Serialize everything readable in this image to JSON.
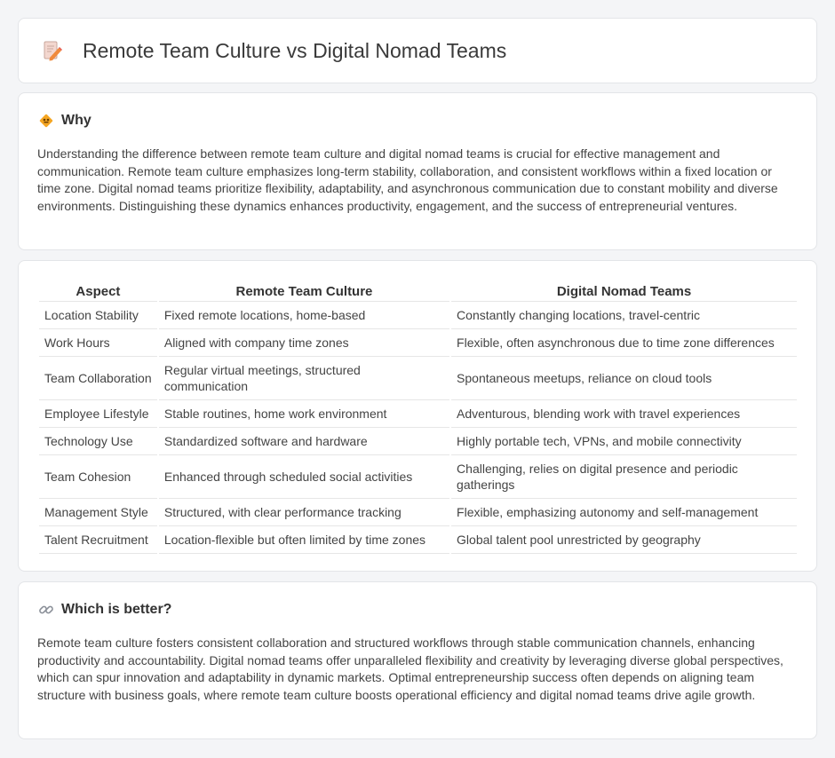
{
  "header": {
    "title": "Remote Team Culture vs Digital Nomad Teams",
    "icon": "pencil-document-icon"
  },
  "why": {
    "heading": "Why",
    "icon": "diamond-sign-icon",
    "text": "Understanding the difference between remote team culture and digital nomad teams is crucial for effective management and communication. Remote team culture emphasizes long-term stability, collaboration, and consistent workflows within a fixed location or time zone. Digital nomad teams prioritize flexibility, adaptability, and asynchronous communication due to constant mobility and diverse environments. Distinguishing these dynamics enhances productivity, engagement, and the success of entrepreneurial ventures."
  },
  "comparison": {
    "headers": [
      "Aspect",
      "Remote Team Culture",
      "Digital Nomad Teams"
    ],
    "rows": [
      [
        "Location Stability",
        "Fixed remote locations, home-based",
        "Constantly changing locations, travel-centric"
      ],
      [
        "Work Hours",
        "Aligned with company time zones",
        "Flexible, often asynchronous due to time zone differences"
      ],
      [
        "Team Collaboration",
        "Regular virtual meetings, structured communication",
        "Spontaneous meetups, reliance on cloud tools"
      ],
      [
        "Employee Lifestyle",
        "Stable routines, home work environment",
        "Adventurous, blending work with travel experiences"
      ],
      [
        "Technology Use",
        "Standardized software and hardware",
        "Highly portable tech, VPNs, and mobile connectivity"
      ],
      [
        "Team Cohesion",
        "Enhanced through scheduled social activities",
        "Challenging, relies on digital presence and periodic gatherings"
      ],
      [
        "Management Style",
        "Structured, with clear performance tracking",
        "Flexible, emphasizing autonomy and self-management"
      ],
      [
        "Talent Recruitment",
        "Location-flexible but often limited by time zones",
        "Global talent pool unrestricted by geography"
      ]
    ]
  },
  "better": {
    "heading": "Which is better?",
    "icon": "link-icon",
    "text": "Remote team culture fosters consistent collaboration and structured workflows through stable communication channels, enhancing productivity and accountability. Digital nomad teams offer unparalleled flexibility and creativity by leveraging diverse global perspectives, which can spur innovation and adaptability in dynamic markets. Optimal entrepreneurship success often depends on aligning team structure with business goals, where remote team culture boosts operational efficiency and digital nomad teams drive agile growth."
  }
}
